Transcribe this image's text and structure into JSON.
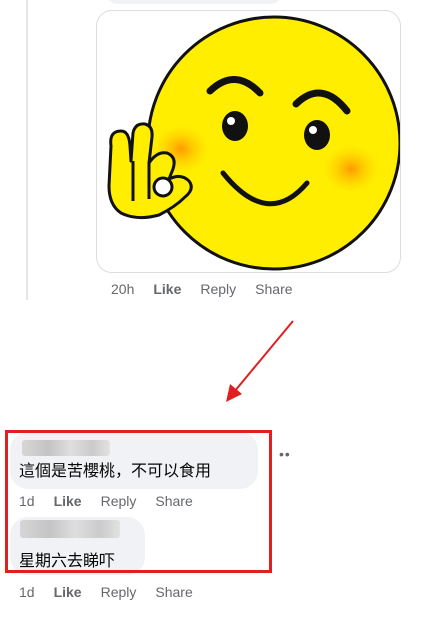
{
  "post_reply": {
    "sticker_name": "ok-hand-smiley-sticker",
    "time": "20h",
    "like_label": "Like",
    "reply_label": "Reply",
    "share_label": "Share"
  },
  "annotation": {
    "arrow_color": "#e02020",
    "box_color": "#e02020"
  },
  "comments": [
    {
      "author": "",
      "text": "這個是苦櫻桃，不可以食用",
      "time": "1d",
      "like_label": "Like",
      "reply_label": "Reply",
      "share_label": "Share"
    },
    {
      "author": "",
      "text": "星期六去睇吓",
      "time": "1d",
      "like_label": "Like",
      "reply_label": "Reply",
      "share_label": "Share"
    }
  ],
  "colors": {
    "bubble_bg": "#f0f2f5",
    "meta_text": "#65676b",
    "sticker_face": "#ffee00"
  }
}
